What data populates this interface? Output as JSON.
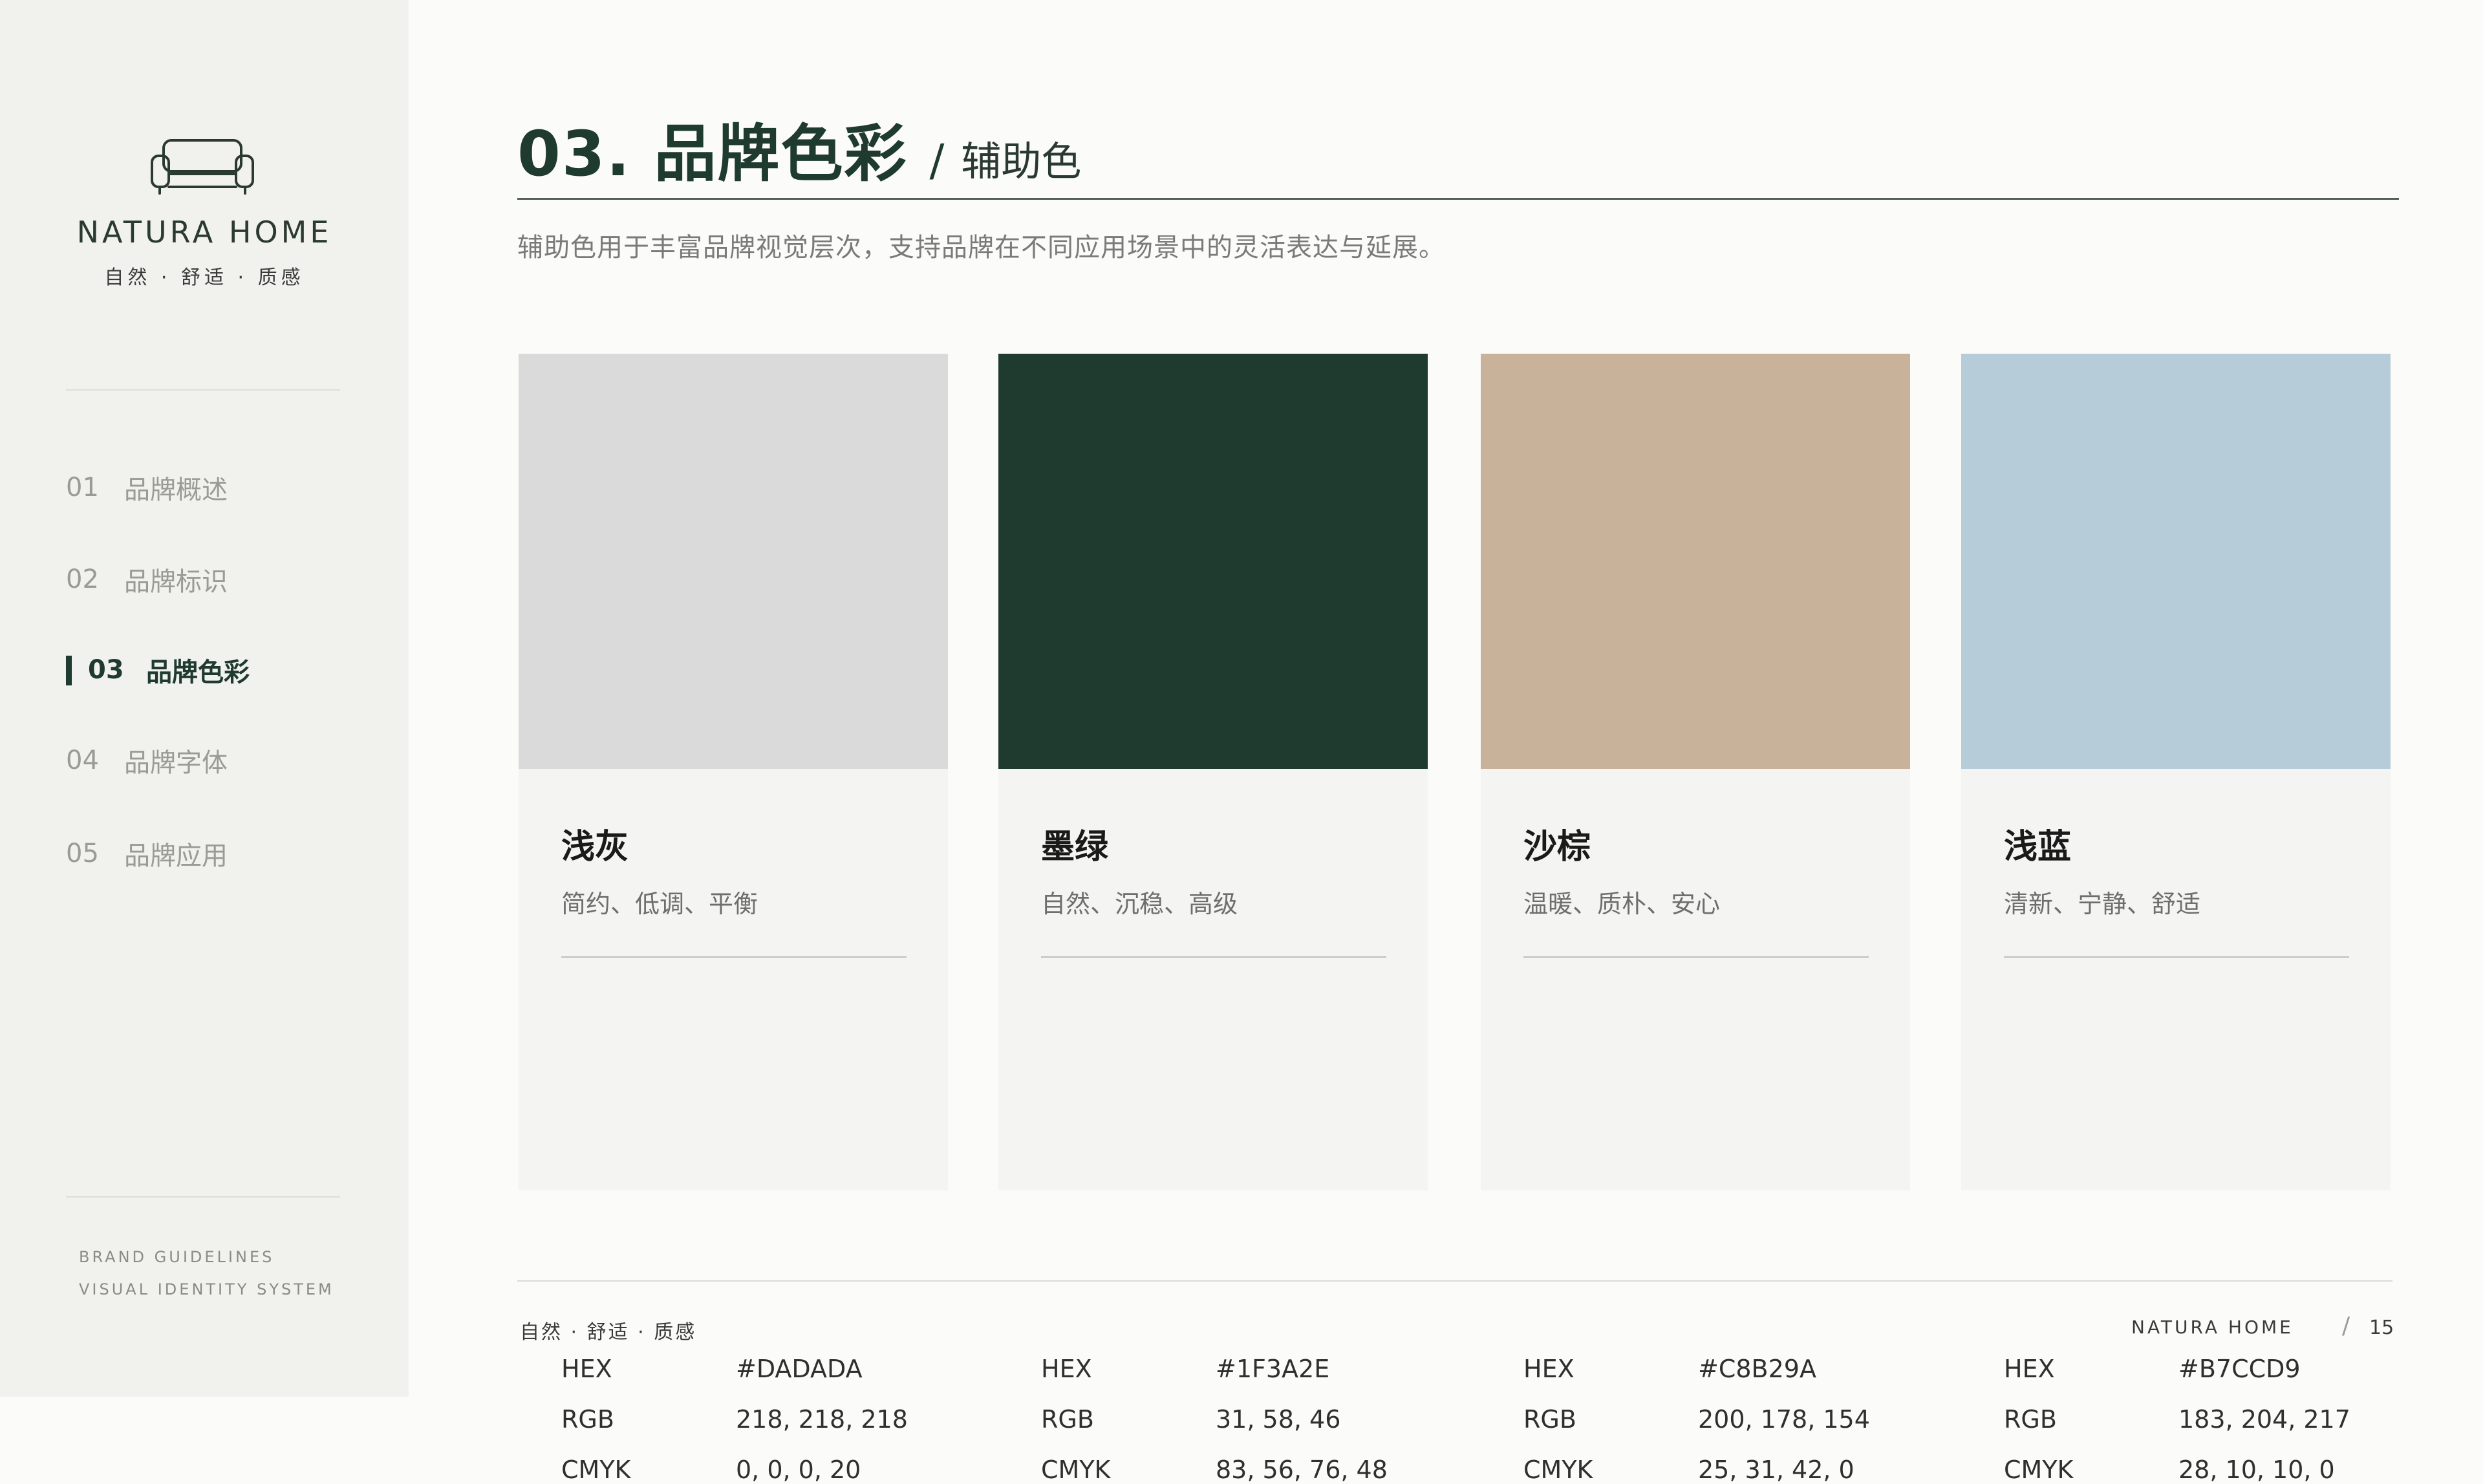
{
  "sidebar": {
    "brand_name": "NATURA HOME",
    "brand_tagline": "自然 · 舒适 · 质感",
    "nav": [
      {
        "num": "01",
        "label": "品牌概述"
      },
      {
        "num": "02",
        "label": "品牌标识"
      },
      {
        "num": "03",
        "label": "品牌色彩"
      },
      {
        "num": "04",
        "label": "品牌字体"
      },
      {
        "num": "05",
        "label": "品牌应用"
      }
    ],
    "active_index": 2,
    "footer_line1": "BRAND GUIDELINES",
    "footer_line2": "VISUAL IDENTITY SYSTEM"
  },
  "header": {
    "title": "03. 品牌色彩",
    "slash": "/",
    "subtitle": "辅助色",
    "description": "辅助色用于丰富品牌视觉层次，支持品牌在不同应用场景中的灵活表达与延展。"
  },
  "labels": {
    "hex": "HEX",
    "rgb": "RGB",
    "cmyk": "CMYK"
  },
  "colors": [
    {
      "name": "浅灰",
      "keywords": "简约、低调、平衡",
      "hex": "#DADADA",
      "rgb": "218, 218, 218",
      "cmyk": "0, 0, 0, 20"
    },
    {
      "name": "墨绿",
      "keywords": "自然、沉稳、高级",
      "hex": "#1F3A2E",
      "rgb": "31, 58, 46",
      "cmyk": "83, 56, 76, 48"
    },
    {
      "name": "沙棕",
      "keywords": "温暖、质朴、安心",
      "hex": "#C8B29A",
      "rgb": "200, 178, 154",
      "cmyk": "25, 31, 42, 0"
    },
    {
      "name": "浅蓝",
      "keywords": "清新、宁静、舒适",
      "hex": "#B7CCD9",
      "rgb": "183, 204, 217",
      "cmyk": "28, 10, 10, 0"
    }
  ],
  "footer": {
    "tagline": "自然 · 舒适 · 质感",
    "brand": "NATURA HOME",
    "slash": "/",
    "page": "15"
  }
}
